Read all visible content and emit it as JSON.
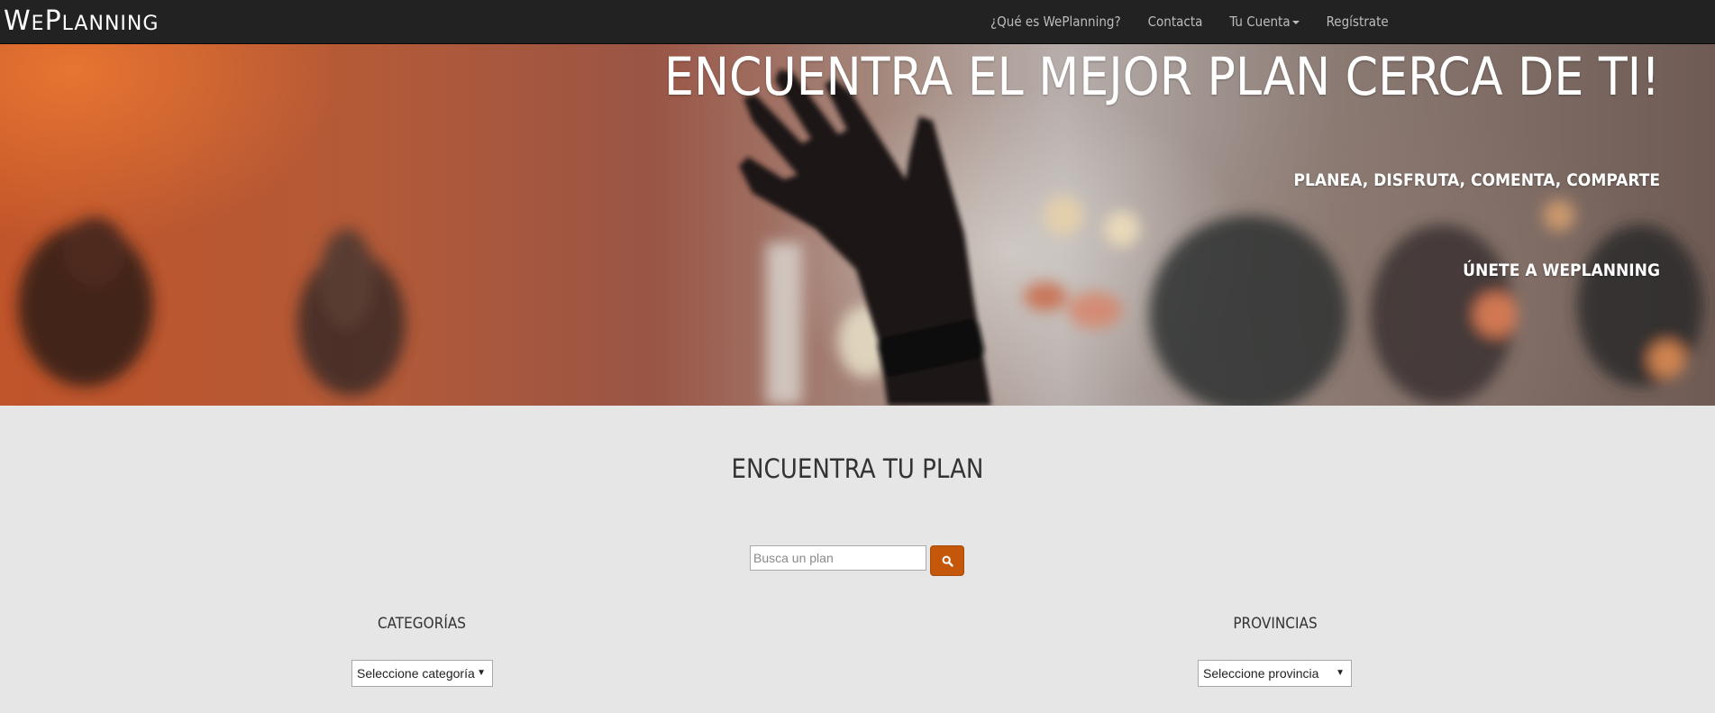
{
  "navbar": {
    "brand_we_big": "W",
    "brand_we_small": "E",
    "brand_planning_big": "P",
    "brand_planning_small": "LANNING",
    "links": [
      {
        "label": "¿Qué es WePlanning?"
      },
      {
        "label": "Contacta"
      },
      {
        "label": "Tu Cuenta"
      },
      {
        "label": "Regístrate"
      }
    ]
  },
  "hero": {
    "title": "Encuentra el mejor plan cerca de ti!",
    "subtitle": "Planea, disfruta, comenta, comparte",
    "join": "Únete a WePlanning"
  },
  "search": {
    "title": "Encuentra tu plan",
    "placeholder": "Busca un plan",
    "button_icon": "search-icon"
  },
  "filters": {
    "categories_label": "Categorías",
    "categories_selected": "Seleccione categoría",
    "provinces_label": "Provincias",
    "provinces_selected": "Seleccione provincia"
  },
  "colors": {
    "navbar_bg": "#222222",
    "accent": "#c4570a",
    "page_bg": "#e6e6e6"
  }
}
